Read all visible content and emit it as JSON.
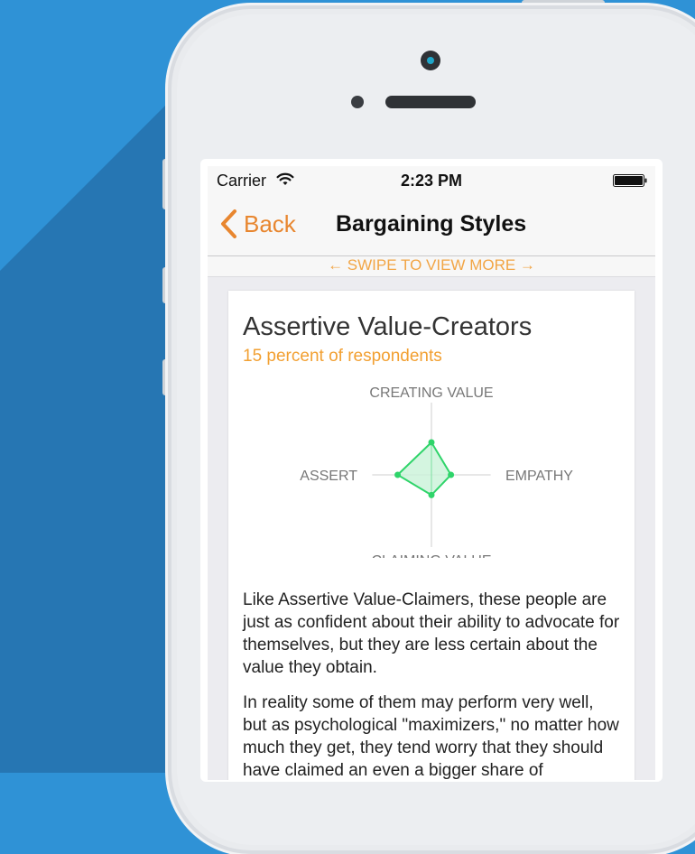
{
  "status_bar": {
    "carrier": "Carrier",
    "time": "2:23 PM",
    "wifi_icon": "wifi-icon",
    "battery_icon": "battery-icon"
  },
  "nav": {
    "back_label": "Back",
    "title": "Bargaining Styles"
  },
  "swipe_hint": "← SWIPE TO VIEW MORE →",
  "card": {
    "title": "Assertive Value-Creators",
    "subtitle": "15 percent of respondents",
    "paragraphs": [
      "Like Assertive Value-Claimers, these people are just as confident about their ability to advocate for themselves, but they are less certain about the value they obtain.",
      "In reality some of them may perform very well, but as psychological \"maximizers,\" no matter how much they get, they tend worry that they should have claimed an even a bigger share of"
    ]
  },
  "chart_data": {
    "type": "radar",
    "axes": [
      "CREATING VALUE",
      "EMPATHY",
      "CLAIMING VALUE",
      "ASSERT"
    ],
    "values": [
      0.45,
      0.3,
      0.28,
      0.52
    ],
    "range": [
      0,
      1
    ],
    "colors": {
      "fill": "#c9f3d8",
      "stroke": "#2fd46a",
      "axis": "#cfcfcf",
      "label": "#777777"
    }
  },
  "colors": {
    "accent": "#e8862f",
    "subtitle": "#f2a032",
    "background": "#2f92d6"
  }
}
